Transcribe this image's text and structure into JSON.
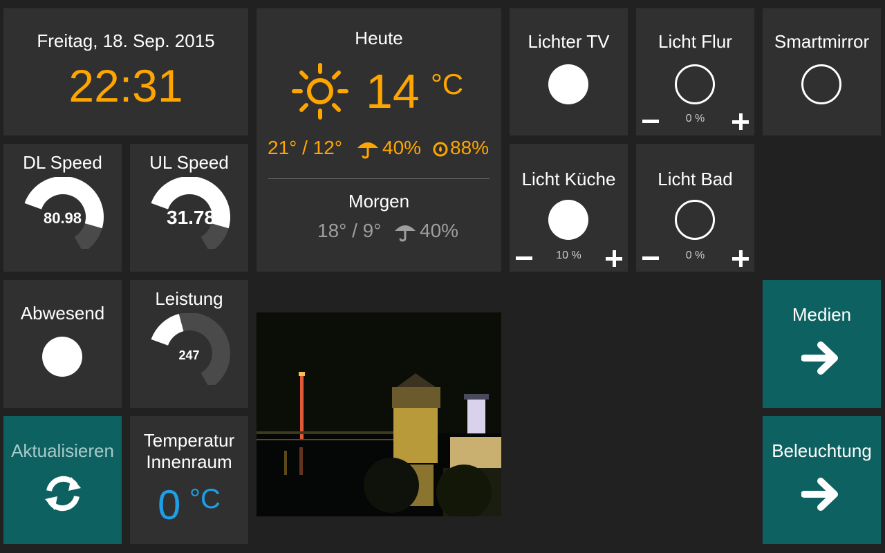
{
  "clock": {
    "date": "Freitag, 18. Sep. 2015",
    "time": "22:31"
  },
  "weather": {
    "today_label": "Heute",
    "temp": "14",
    "unit": "°C",
    "high_low": "21° / 12°",
    "rain": "40%",
    "humidity": "88%",
    "tomorrow_label": "Morgen",
    "tomorrow_high_low": "18° / 9°",
    "tomorrow_rain": "40%"
  },
  "switches": {
    "lichter_tv": {
      "label": "Lichter TV",
      "state": "on"
    },
    "licht_flur": {
      "label": "Licht Flur",
      "percent": "0 %"
    },
    "smartmirror": {
      "label": "Smartmirror",
      "state": "off"
    },
    "licht_kueche": {
      "label": "Licht Küche",
      "percent": "10 %"
    },
    "licht_bad": {
      "label": "Licht Bad",
      "percent": "0 %"
    },
    "abwesend": {
      "label": "Abwesend",
      "state": "on"
    }
  },
  "gauges": {
    "dl": {
      "label": "DL Speed",
      "value": "80.98",
      "fraction": 0.8
    },
    "ul": {
      "label": "UL Speed",
      "value": "31.78",
      "fraction": 0.8
    },
    "leistung": {
      "label": "Leistung",
      "value": "247",
      "fraction": 0.25
    }
  },
  "actions": {
    "refresh": "Aktualisieren",
    "medien": "Medien",
    "beleuchtung": "Beleuchtung"
  },
  "indoor": {
    "label_line1": "Temperatur",
    "label_line2": "Innenraum",
    "value": "0",
    "unit": "°C"
  },
  "colors": {
    "accent": "#ffa500",
    "teal": "#0e6161",
    "tile": "#303030",
    "background": "#212121",
    "blue": "#1e9ee6"
  },
  "icons": [
    "sun-icon",
    "umbrella-icon",
    "humidity-icon",
    "refresh-icon",
    "arrow-right-icon"
  ]
}
